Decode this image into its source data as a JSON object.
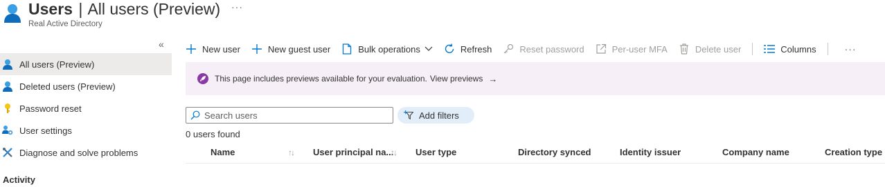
{
  "header": {
    "title_bold": "Users",
    "title_sep": "|",
    "title_rest": "All users (Preview)",
    "more": "···",
    "subtitle": "Real Active Directory",
    "icon": "user-icon"
  },
  "sidebar": {
    "collapse": "«",
    "items": [
      {
        "label": "All users (Preview)",
        "icon": "user-icon",
        "active": true
      },
      {
        "label": "Deleted users (Preview)",
        "icon": "user-icon"
      },
      {
        "label": "Password reset",
        "icon": "key-icon"
      },
      {
        "label": "User settings",
        "icon": "users-gear-icon"
      },
      {
        "label": "Diagnose and solve problems",
        "icon": "wrench-icon"
      }
    ],
    "section": "Activity"
  },
  "toolbar": {
    "new_user": "New user",
    "new_guest_user": "New guest user",
    "bulk_operations": "Bulk operations",
    "refresh": "Refresh",
    "reset_password": "Reset password",
    "per_user_mfa": "Per-user MFA",
    "delete_user": "Delete user",
    "columns": "Columns",
    "more": "···"
  },
  "banner": {
    "text": "This page includes previews available for your evaluation.",
    "link": "View previews",
    "arrow": "→",
    "icon": "rocket-icon"
  },
  "search": {
    "placeholder": "Search users",
    "value": ""
  },
  "filter": {
    "label": "Add filters"
  },
  "results": {
    "count": "0 users found"
  },
  "table": {
    "columns": [
      "Name",
      "User principal na...",
      "User type",
      "Directory synced",
      "Identity issuer",
      "Company name",
      "Creation type"
    ],
    "sort_glyph": "↑↓"
  },
  "colors": {
    "accent": "#0078d4",
    "banner_bg": "#f6eff8",
    "banner_icon": "#8a3aa5",
    "active_nav": "#edebe9",
    "filter_pill": "#e1eefa"
  }
}
